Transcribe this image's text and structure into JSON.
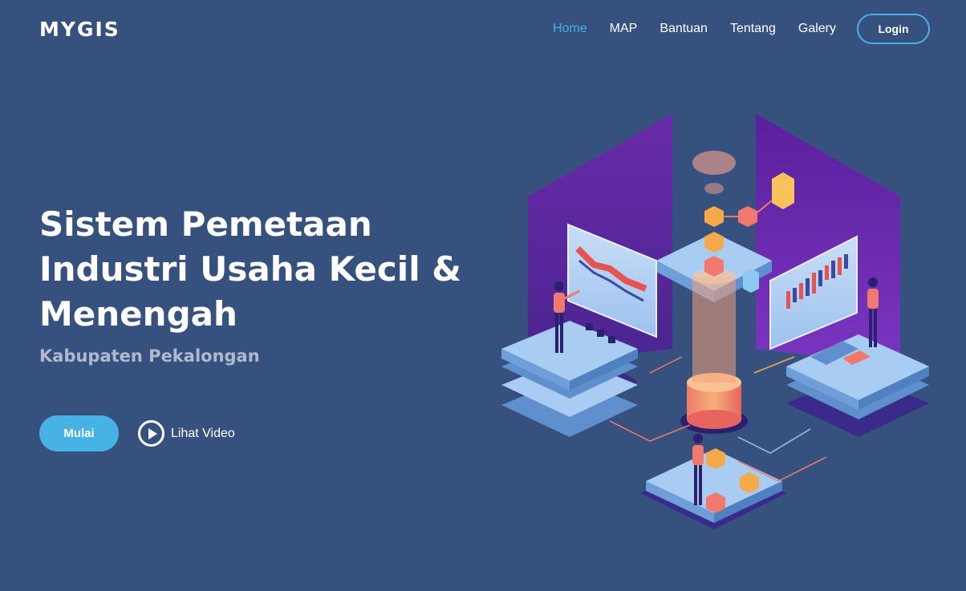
{
  "header": {
    "logo": "MYGIS",
    "nav": [
      {
        "label": "Home",
        "active": true
      },
      {
        "label": "MAP"
      },
      {
        "label": "Bantuan"
      },
      {
        "label": "Tentang"
      },
      {
        "label": "Galery"
      }
    ],
    "login_label": "Login"
  },
  "hero": {
    "title_line1": "Sistem Pemetaan",
    "title_line2": "Industri Usaha Kecil &",
    "title_line3": "Menengah",
    "subtitle": "Kabupaten Pekalongan",
    "start_label": "Mulai",
    "video_label": "Lihat Video"
  },
  "colors": {
    "background": "#37517e",
    "accent": "#47b2e4"
  }
}
